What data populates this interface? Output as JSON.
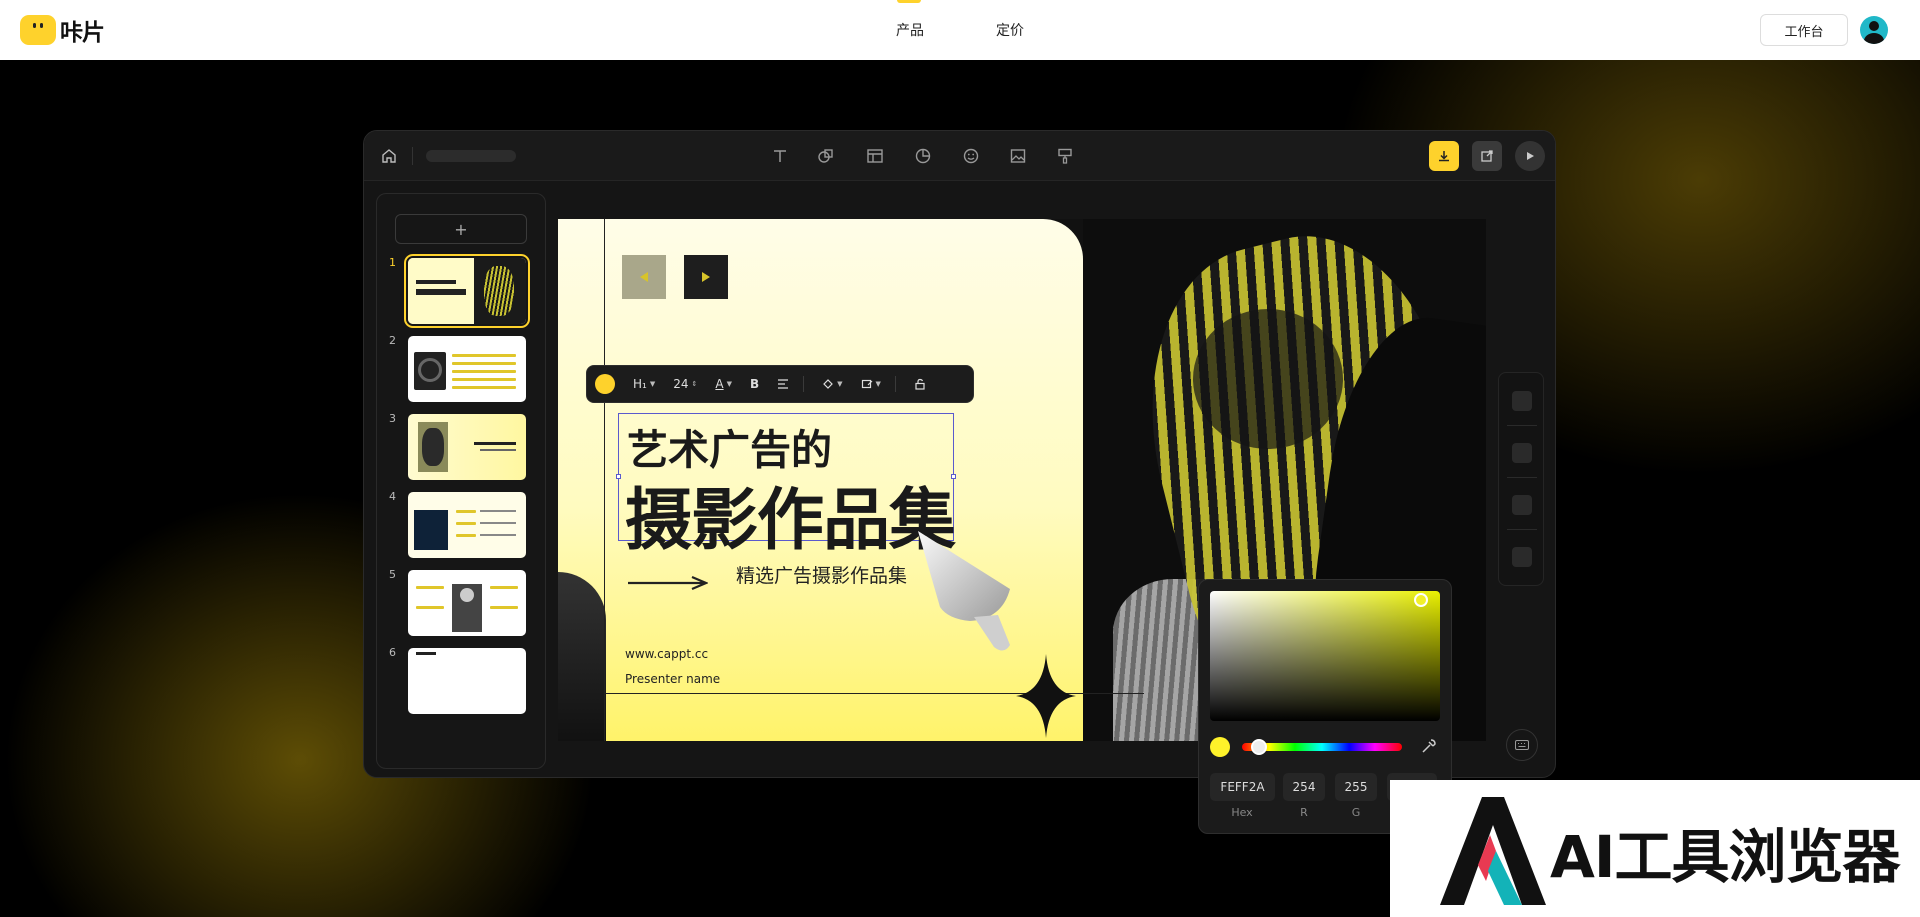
{
  "topbar": {
    "logo_text": "咔片",
    "nav": [
      "产品",
      "定价"
    ],
    "workbench_label": "工作台"
  },
  "editor": {
    "add_slide_label": "+",
    "slide_numbers": [
      "1",
      "2",
      "3",
      "4",
      "5",
      "6"
    ],
    "active_slide": 1
  },
  "slide": {
    "title_line1": "艺术广告的",
    "title_line2": "摄影作品集",
    "subtitle": "精选广告摄影作品集",
    "url": "www.cappt.cc",
    "presenter": "Presenter name"
  },
  "text_toolbar": {
    "heading_label": "H₁",
    "font_size": "24",
    "font_color_label": "A",
    "bold_label": "B"
  },
  "color_picker": {
    "hex_value": "FEFF2A",
    "r_value": "254",
    "g_value": "255",
    "hex_label": "Hex",
    "r_label": "R",
    "g_label": "G",
    "selected_color": "#FEFF2A"
  },
  "watermark": {
    "text": "AI工具浏览器"
  },
  "colors": {
    "accent": "#fed22c"
  }
}
